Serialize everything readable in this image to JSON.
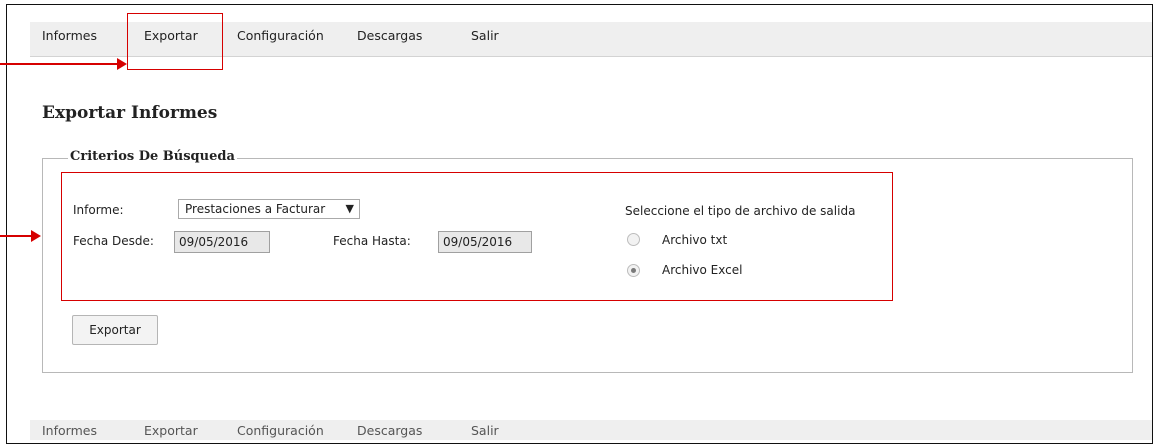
{
  "nav": {
    "items": [
      {
        "label": "Informes"
      },
      {
        "label": "Exportar"
      },
      {
        "label": "Configuración"
      },
      {
        "label": "Descargas"
      },
      {
        "label": "Salir"
      }
    ]
  },
  "page": {
    "title": "Exportar Informes"
  },
  "criteria": {
    "legend": "Criterios De Búsqueda",
    "informe_label": "Informe:",
    "informe_value": "Prestaciones a Facturar",
    "informe_chevron": "▼",
    "fecha_desde_label": "Fecha Desde:",
    "fecha_desde_value": "09/05/2016",
    "fecha_hasta_label": "Fecha Hasta:",
    "fecha_hasta_value": "09/05/2016",
    "file_type_label": "Seleccione el tipo de archivo de salida",
    "options": [
      {
        "label": "Archivo txt",
        "selected": false
      },
      {
        "label": "Archivo Excel",
        "selected": true
      }
    ]
  },
  "actions": {
    "export_label": "Exportar"
  },
  "colors": {
    "highlight": "#d60000",
    "nav_bg": "#efefef"
  }
}
